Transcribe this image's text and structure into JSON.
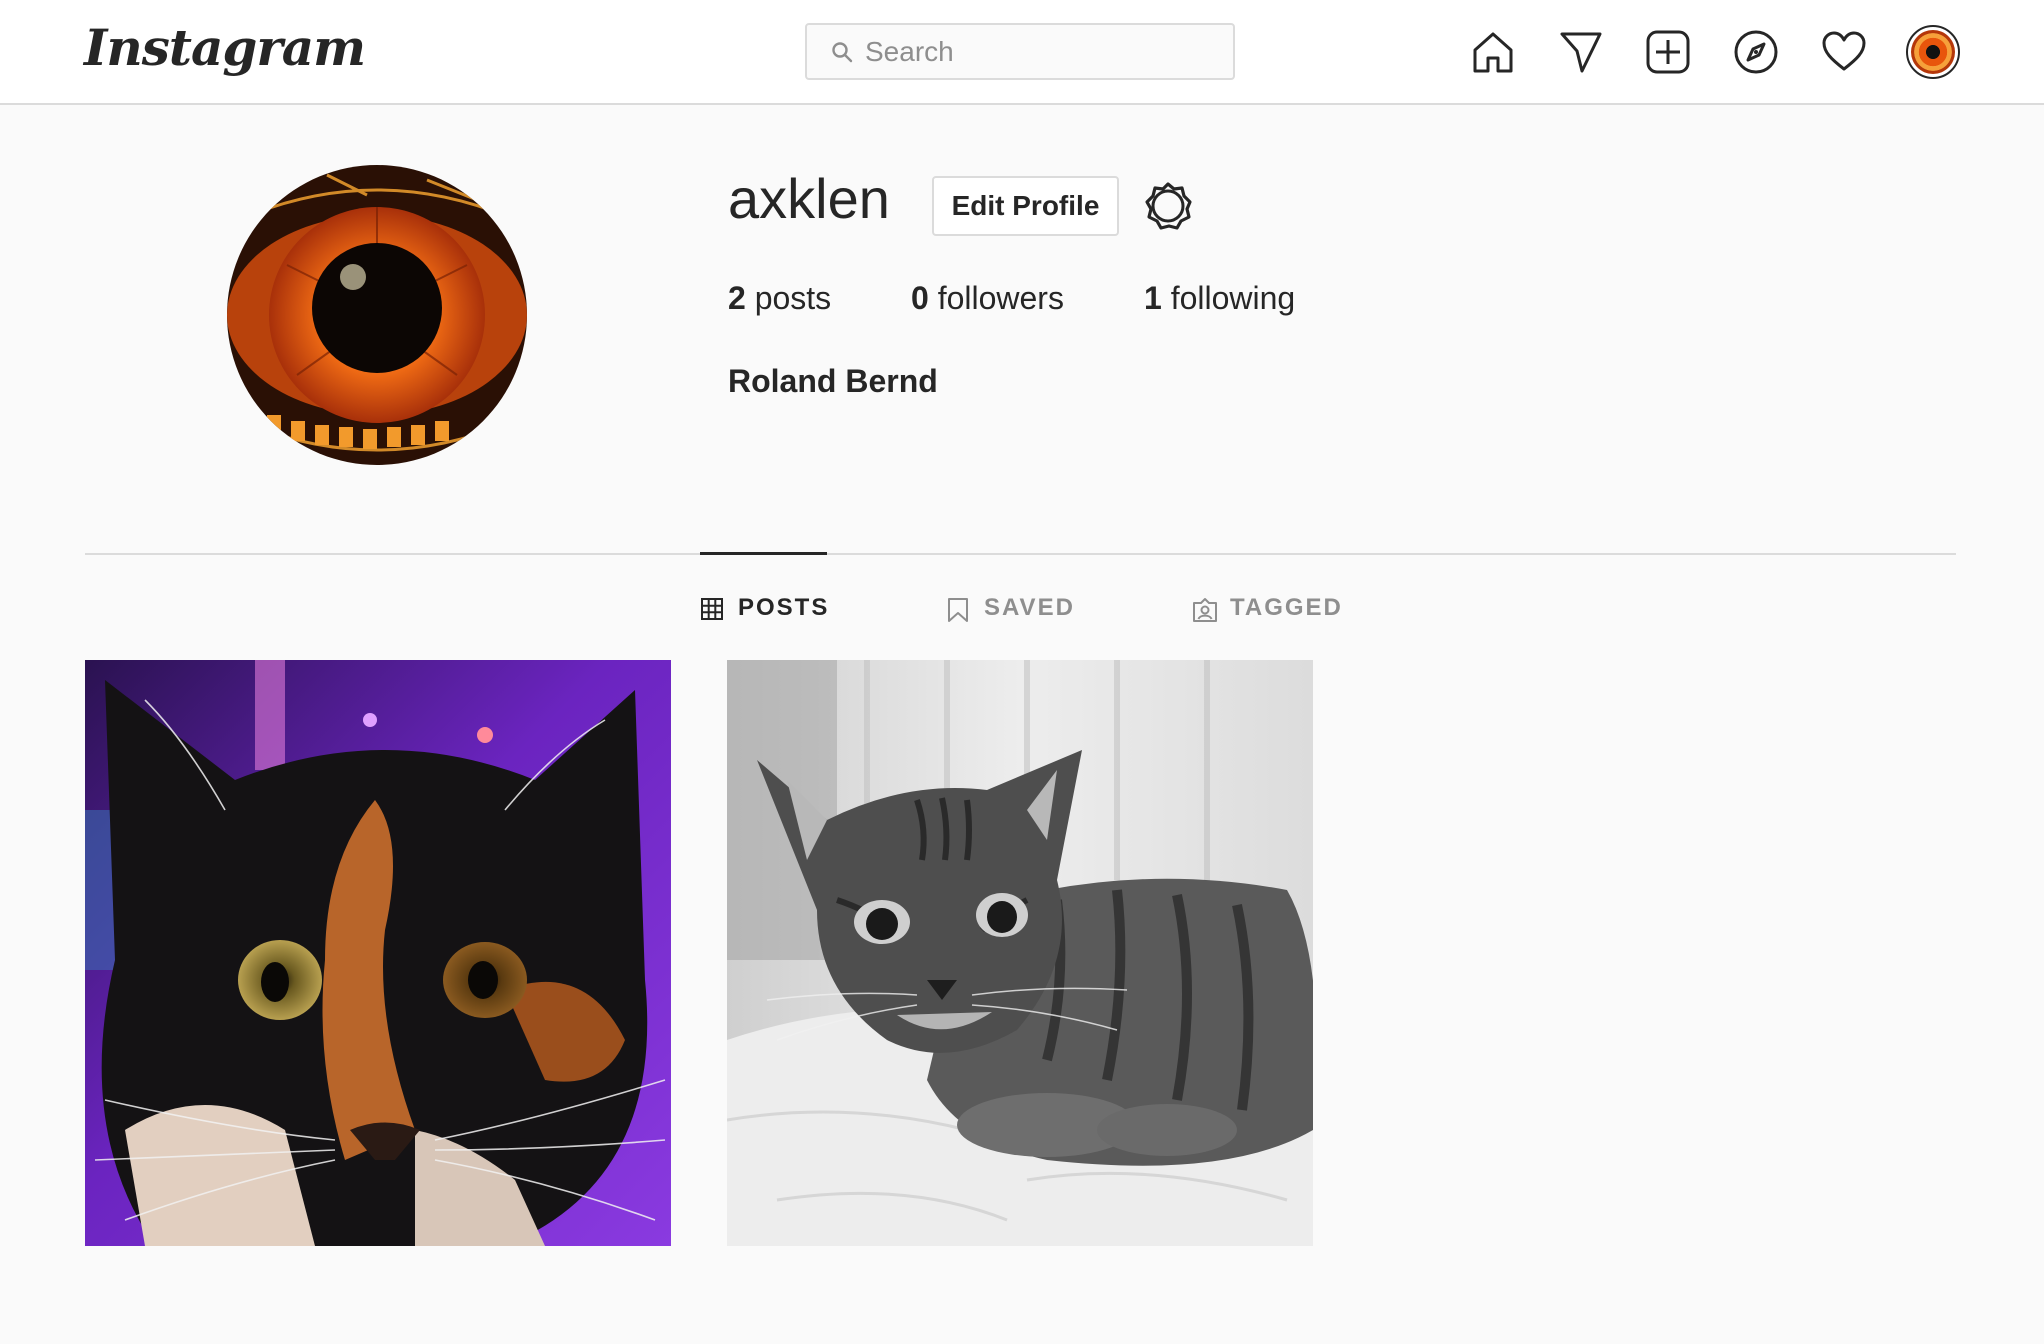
{
  "header": {
    "logo": "Instagram",
    "search": {
      "placeholder": "Search",
      "value": ""
    },
    "nav_icons": [
      "home-icon",
      "direct-message-icon",
      "new-post-icon",
      "explore-icon",
      "activity-heart-icon",
      "profile-avatar"
    ]
  },
  "profile": {
    "username": "axklen",
    "edit_button_label": "Edit Profile",
    "stats": {
      "posts_count": "2",
      "posts_label": "posts",
      "followers_count": "0",
      "followers_label": "followers",
      "following_count": "1",
      "following_label": "following"
    },
    "full_name": "Roland Bernd"
  },
  "tabs": [
    {
      "label": "POSTS",
      "icon": "grid-icon",
      "active": true
    },
    {
      "label": "SAVED",
      "icon": "bookmark-icon",
      "active": false
    },
    {
      "label": "TAGGED",
      "icon": "tagged-icon",
      "active": false
    }
  ],
  "posts": [
    {
      "subject": "calico cat close-up",
      "colors": [
        "#3a1a6e",
        "#7a2ad8",
        "#141214",
        "#b8652a"
      ]
    },
    {
      "subject": "tabby cat lying on blanket (black and white)",
      "colors": [
        "#e6e6e6",
        "#7a7a7a",
        "#2c2c2c"
      ]
    }
  ],
  "colors": {
    "text": "#262626",
    "muted": "#8e8e8e",
    "border": "#dbdbdb",
    "background": "#fafafa"
  }
}
